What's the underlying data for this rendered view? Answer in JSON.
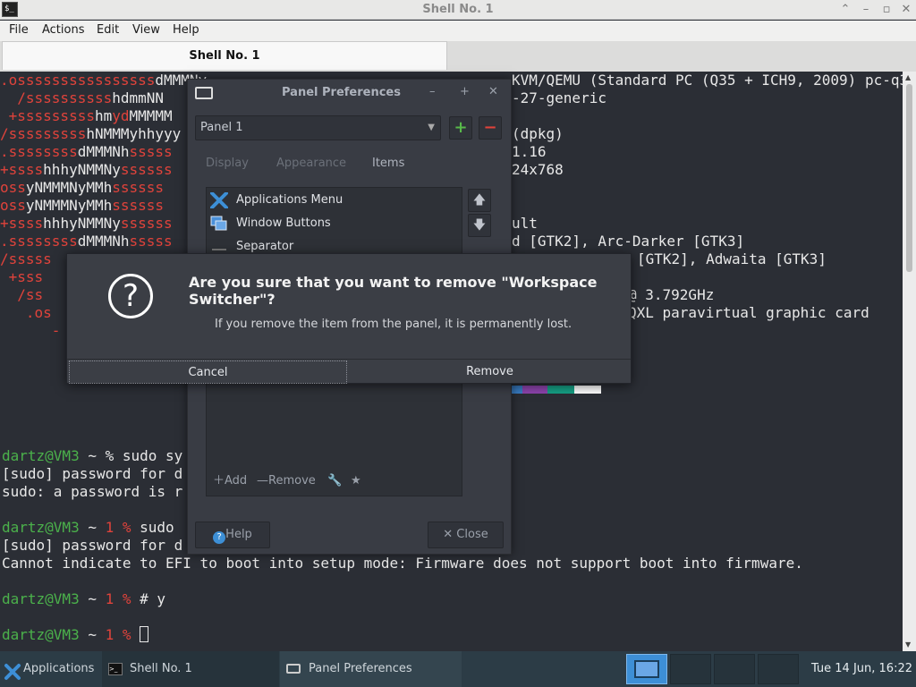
{
  "window": {
    "title": "Shell No. 1",
    "app_icon_text": "$_",
    "menu": [
      "File",
      "Actions",
      "Edit",
      "View",
      "Help"
    ],
    "tab": "Shell No. 1"
  },
  "terminal": {
    "lines": [
      {
        "left": ".ossssssssssssssss",
        "lc": "red",
        "mid": "dMMMNy",
        "right": "KVM/QEMU (Standard PC (Q35 + ICH9, 2009) pc-q35-6."
      },
      {
        "left": "  /ssssssssss",
        "lc": "red",
        "mid": "hdmmNN",
        "right": "-27-generic"
      },
      {
        "left": " +sssssssss",
        "lc": "red",
        "mid": "hm",
        "mid2": "yd",
        "mid3": "MMMMM",
        "right": ""
      },
      {
        "left": "/sssssssss",
        "lc": "red",
        "mid": "hNMMMyhhyyy",
        "right": "(dpkg)"
      },
      {
        "left": ".ssssssss",
        "lc": "red",
        "mid": "dMMMNh",
        "mid2": "sssss",
        "right": "1.16"
      },
      {
        "left": "+ssss",
        "lc": "red",
        "mid": "hhhyNMMNy",
        "mid2": "ssssss",
        "right": "24x768"
      },
      {
        "left": "oss",
        "lc": "red",
        "mid": "yNMMMNyMMh",
        "mid2": "ssssss",
        "right": ""
      },
      {
        "left": "oss",
        "lc": "red",
        "mid": "yNMMMNyMMh",
        "mid2": "ssssss",
        "right": ""
      },
      {
        "left": "+ssss",
        "lc": "red",
        "mid": "hhhyNMMNy",
        "mid2": "ssssss",
        "right": "ult"
      },
      {
        "left": ".ssssssss",
        "lc": "red",
        "mid": "dMMMNh",
        "mid2": "sssss",
        "right": "d [GTK2], Arc-Darker [GTK3]"
      },
      {
        "left": "/sssss",
        "lc": "red",
        "mid": "",
        "right": "[GTK2], Adwaita [GTK3]"
      },
      {
        "left": " +sss",
        "lc": "red",
        "mid": "",
        "right": ""
      },
      {
        "left": "  /ss",
        "lc": "red",
        "mid": "",
        "right": "@ 3.792GHz"
      },
      {
        "left": "   .os",
        "lc": "red",
        "mid": "",
        "right": "QXL paravirtual graphic card"
      },
      {
        "left": "      -",
        "lc": "red",
        "mid": "",
        "right": ""
      }
    ],
    "prompt_user": "dartz@VM3",
    "cmd1": " ~ % sudo sy",
    "out1": "[sudo] password for d",
    "out2": "sudo: a password is r",
    "cmd2_pre": " ~ ",
    "cmd2_code": "1 %",
    "cmd2_post": " sudo ",
    "out3": "[sudo] password for d",
    "out4": "Cannot indicate to EFI to boot into setup mode: Firmware does not support boot into firmware.",
    "cmd3_post": " # y",
    "cmd4_post": " "
  },
  "colors": {
    "swatches": [
      "#3a7fc7",
      "#8e44ad",
      "#16a085",
      "#ffffff"
    ]
  },
  "prefs": {
    "title": "Panel Preferences",
    "panel_select": "Panel 1",
    "add_symbol": "+",
    "remove_symbol": "−",
    "tabs": [
      "Display",
      "Appearance",
      "Items"
    ],
    "items": [
      "Applications Menu",
      "Window Buttons",
      "Separator"
    ],
    "tool_add": "Add",
    "tool_remove": "Remove",
    "help": "Help",
    "close": "Close"
  },
  "confirm": {
    "heading": "Are you sure that you want to remove \"Workspace Switcher\"?",
    "body": "If you remove the item from the panel, it is permanently lost.",
    "cancel": "Cancel",
    "remove": "Remove"
  },
  "taskbar": {
    "apps_label": "Applications",
    "task1": "Shell No. 1",
    "task2": "Panel Preferences",
    "clock": "Tue 14 Jun, 16:22"
  }
}
